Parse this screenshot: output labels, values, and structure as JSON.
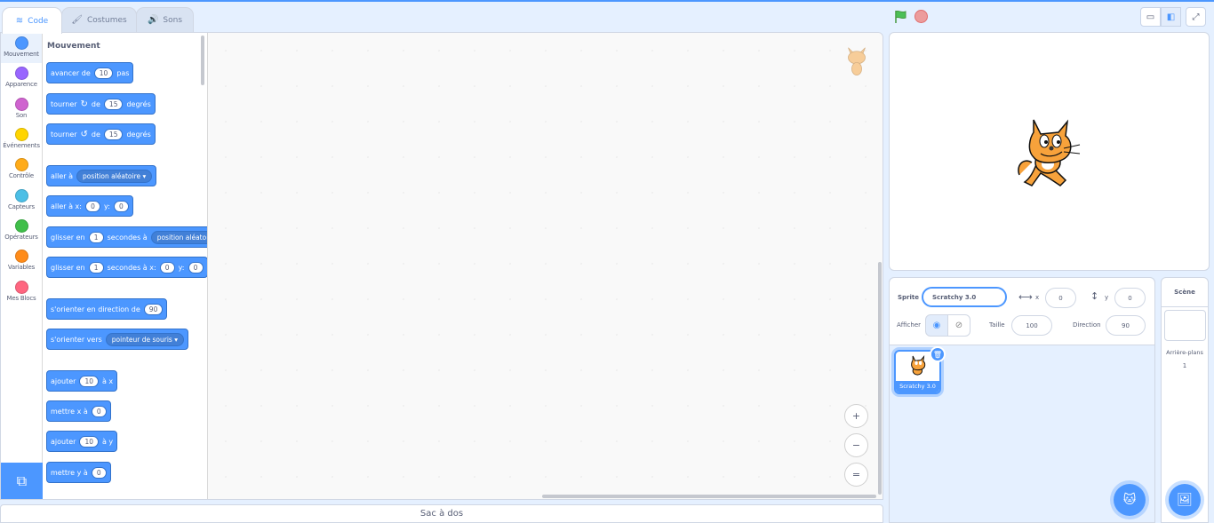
{
  "tabs": {
    "code": "Code",
    "costumes": "Costumes",
    "sounds": "Sons"
  },
  "categories": [
    {
      "label": "Mouvement",
      "color": "#4c97ff"
    },
    {
      "label": "Apparence",
      "color": "#9966ff"
    },
    {
      "label": "Son",
      "color": "#cf63cf"
    },
    {
      "label": "Événements",
      "color": "#ffd500"
    },
    {
      "label": "Contrôle",
      "color": "#ffab19"
    },
    {
      "label": "Capteurs",
      "color": "#4cbfe6"
    },
    {
      "label": "Opérateurs",
      "color": "#40bf4a"
    },
    {
      "label": "Variables",
      "color": "#ff8c1a"
    },
    {
      "label": "Mes Blocs",
      "color": "#ff6680"
    }
  ],
  "palette": {
    "title": "Mouvement",
    "move": {
      "a": "avancer de",
      "v": "10",
      "b": "pas"
    },
    "turn_right": {
      "a": "tourner",
      "b": "de",
      "v": "15",
      "c": "degrés"
    },
    "turn_left": {
      "a": "tourner",
      "b": "de",
      "v": "15",
      "c": "degrés"
    },
    "goto": {
      "a": "aller à",
      "d": "position aléatoire"
    },
    "goto_xy": {
      "a": "aller à x:",
      "x": "0",
      "b": "y:",
      "y": "0"
    },
    "glide": {
      "a": "glisser en",
      "v": "1",
      "b": "secondes à",
      "d": "position aléatoire"
    },
    "glide_xy": {
      "a": "glisser en",
      "v": "1",
      "b": "secondes à x:",
      "x": "0",
      "c": "y:",
      "y": "0"
    },
    "point_dir": {
      "a": "s'orienter en direction de",
      "v": "90"
    },
    "point_towards": {
      "a": "s'orienter vers",
      "d": "pointeur de souris"
    },
    "change_x": {
      "a": "ajouter",
      "v": "10",
      "b": "à x"
    },
    "set_x": {
      "a": "mettre x à",
      "v": "0"
    },
    "change_y": {
      "a": "ajouter",
      "v": "10",
      "b": "à y"
    },
    "set_y": {
      "a": "mettre y à",
      "v": "0"
    }
  },
  "zoom": {
    "in": "+",
    "out": "−",
    "reset": "="
  },
  "backpack": "Sac à dos",
  "sprite_info": {
    "sprite_label": "Sprite",
    "sprite_name": "Scratchy 3.0",
    "x_label": "x",
    "x": "0",
    "y_label": "y",
    "y": "0",
    "show_label": "Afficher",
    "size_label": "Taille",
    "size": "100",
    "direction_label": "Direction",
    "direction": "90"
  },
  "sprite_tile": {
    "name": "Scratchy 3.0"
  },
  "stage_pane": {
    "title": "Scène",
    "backdrops_label": "Arrière-plans",
    "backdrops_count": "1"
  }
}
